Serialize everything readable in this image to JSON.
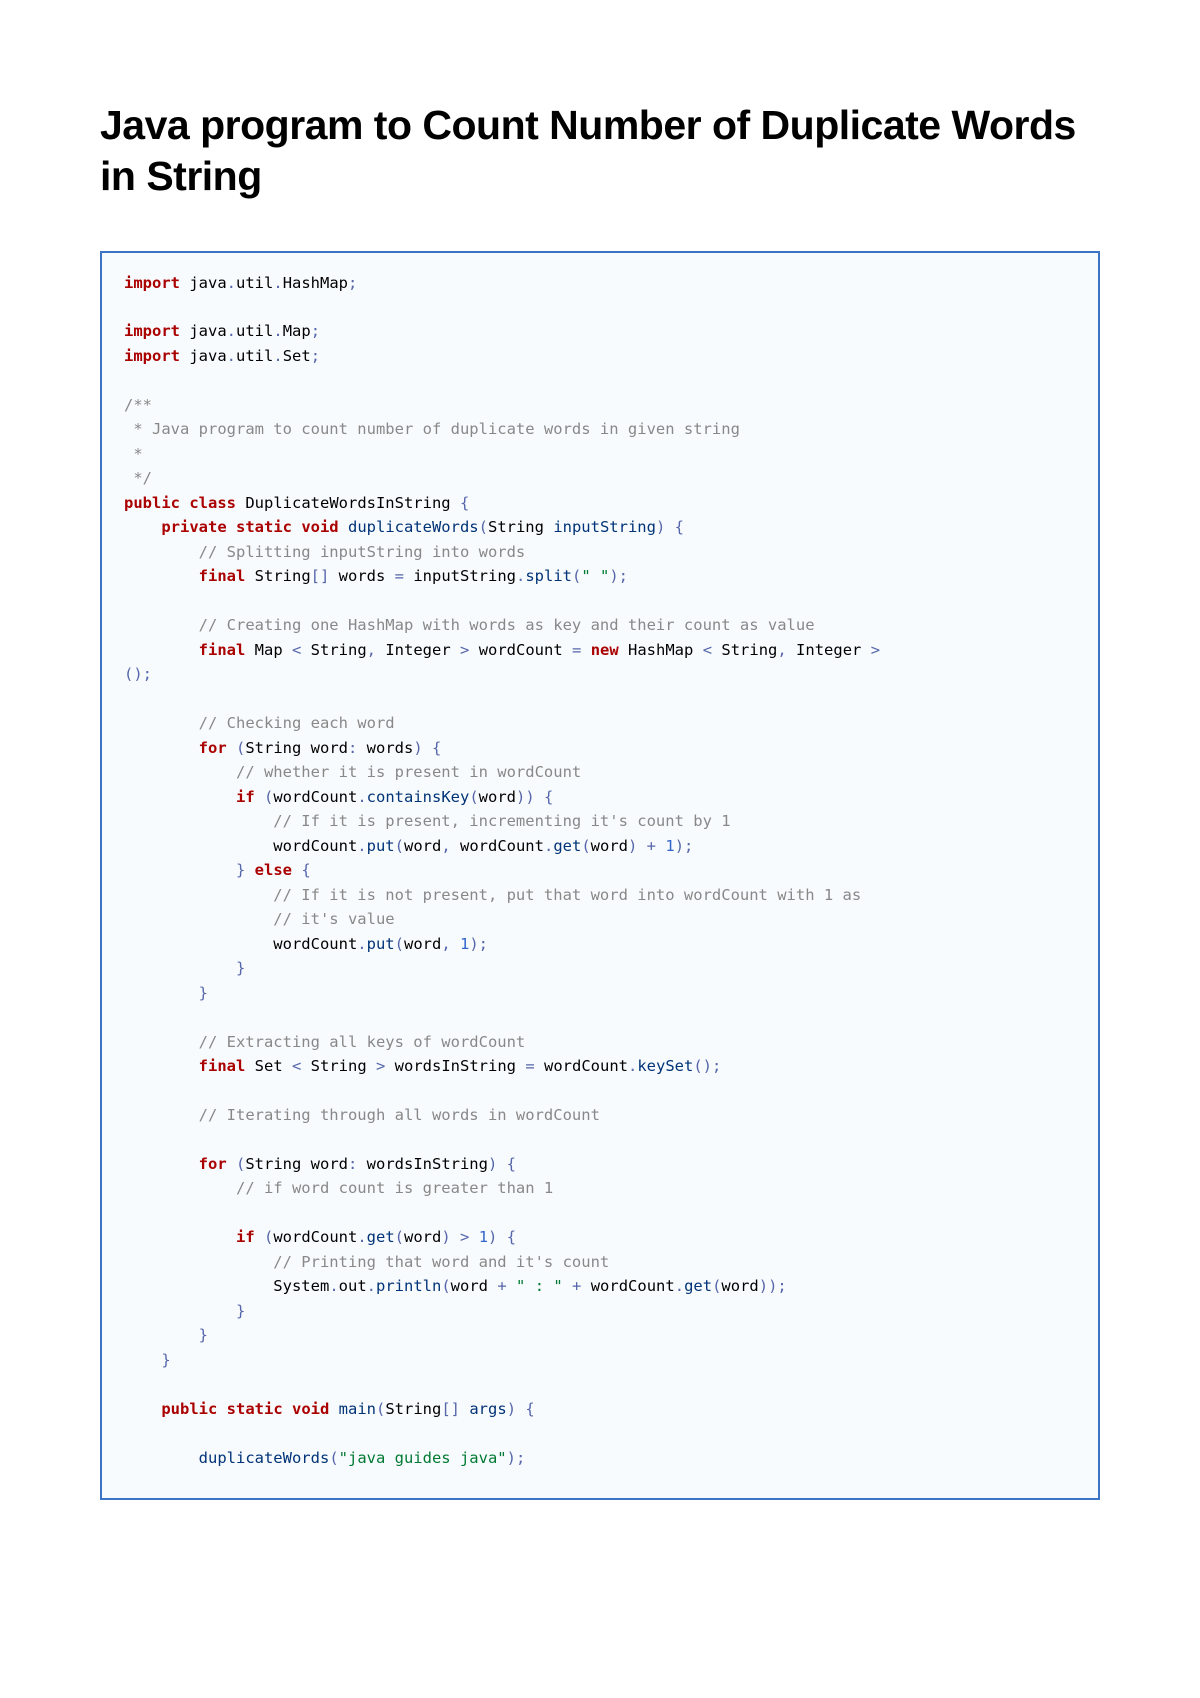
{
  "title": "Java program to Count Number of Duplicate Words in String",
  "code": {
    "l01a": "import",
    "l01b": " java",
    "l01c": ".",
    "l01d": "util",
    "l01e": ".",
    "l01f": "HashMap",
    "l01g": ";",
    "l03a": "import",
    "l03b": " java",
    "l03c": ".",
    "l03d": "util",
    "l03e": ".",
    "l03f": "Map",
    "l03g": ";",
    "l04a": "import",
    "l04b": " java",
    "l04c": ".",
    "l04d": "util",
    "l04e": ".",
    "l04f": "Set",
    "l04g": ";",
    "l06": "/**",
    "l07": " * Java program to count number of duplicate words in given string",
    "l08": " *",
    "l09": " */",
    "l10a": "public",
    "l10b": " class",
    "l10c": " DuplicateWordsInString ",
    "l10d": "{",
    "l11a": "    private",
    "l11b": " static",
    "l11c": " void",
    "l11d": " duplicateWords",
    "l11e": "(",
    "l11f": "String ",
    "l11g": "inputString",
    "l11h": ") {",
    "l12": "        // Splitting inputString into words",
    "l13a": "        final",
    "l13b": " String",
    "l13c": "[]",
    "l13d": " words ",
    "l13e": "=",
    "l13f": " inputString",
    "l13g": ".",
    "l13h": "split",
    "l13i": "(",
    "l13j": "\" \"",
    "l13k": ");",
    "l15": "        // Creating one HashMap with words as key and their count as value",
    "l16a": "        final",
    "l16b": " Map ",
    "l16c": "<",
    "l16d": " String",
    "l16e": ",",
    "l16f": " Integer ",
    "l16g": ">",
    "l16h": " wordCount ",
    "l16i": "=",
    "l16j": " new",
    "l16k": " HashMap ",
    "l16l": "<",
    "l16m": " String",
    "l16n": ",",
    "l16o": " Integer ",
    "l16p": ">",
    "l16q": "",
    "l17": "();",
    "l19": "        // Checking each word",
    "l20a": "        for",
    "l20b": " (",
    "l20c": "String word",
    "l20d": ":",
    "l20e": " words",
    "l20f": ") {",
    "l21": "            // whether it is present in wordCount",
    "l22a": "            if",
    "l22b": " (",
    "l22c": "wordCount",
    "l22d": ".",
    "l22e": "containsKey",
    "l22f": "(",
    "l22g": "word",
    "l22h": ")) {",
    "l23": "                // If it is present, incrementing it's count by 1",
    "l24a": "                wordCount",
    "l24b": ".",
    "l24c": "put",
    "l24d": "(",
    "l24e": "word",
    "l24f": ",",
    "l24g": " wordCount",
    "l24h": ".",
    "l24i": "get",
    "l24j": "(",
    "l24k": "word",
    "l24l": ") ",
    "l24m": "+",
    "l24n": " ",
    "l24o": "1",
    "l24p": ");",
    "l25a": "            } ",
    "l25b": "else",
    "l25c": " {",
    "l26": "                // If it is not present, put that word into wordCount with 1 as",
    "l27": "                // it's value",
    "l28a": "                wordCount",
    "l28b": ".",
    "l28c": "put",
    "l28d": "(",
    "l28e": "word",
    "l28f": ",",
    "l28g": " ",
    "l28h": "1",
    "l28i": ");",
    "l29": "            }",
    "l30": "        }",
    "l32": "        // Extracting all keys of wordCount",
    "l33a": "        final",
    "l33b": " Set ",
    "l33c": "<",
    "l33d": " String ",
    "l33e": ">",
    "l33f": " wordsInString ",
    "l33g": "=",
    "l33h": " wordCount",
    "l33i": ".",
    "l33j": "keySet",
    "l33k": "();",
    "l35": "        // Iterating through all words in wordCount",
    "l37a": "        for",
    "l37b": " (",
    "l37c": "String word",
    "l37d": ":",
    "l37e": " wordsInString",
    "l37f": ") {",
    "l38": "            // if word count is greater than 1",
    "l40a": "            if",
    "l40b": " (",
    "l40c": "wordCount",
    "l40d": ".",
    "l40e": "get",
    "l40f": "(",
    "l40g": "word",
    "l40h": ") ",
    "l40i": ">",
    "l40j": " ",
    "l40k": "1",
    "l40l": ") {",
    "l41": "                // Printing that word and it's count",
    "l42a": "                System",
    "l42b": ".",
    "l42c": "out",
    "l42d": ".",
    "l42e": "println",
    "l42f": "(",
    "l42g": "word ",
    "l42h": "+",
    "l42i": " ",
    "l42j": "\" : \"",
    "l42k": " ",
    "l42l": "+",
    "l42m": " wordCount",
    "l42n": ".",
    "l42o": "get",
    "l42p": "(",
    "l42q": "word",
    "l42r": "));",
    "l43": "            }",
    "l44": "        }",
    "l45": "    }",
    "l47a": "    public",
    "l47b": " static",
    "l47c": " void",
    "l47d": " main",
    "l47e": "(",
    "l47f": "String",
    "l47g": "[]",
    "l47h": " args",
    "l47i": ") {",
    "l49a": "        duplicateWords",
    "l49b": "(",
    "l49c": "\"java guides java\"",
    "l49d": ");"
  }
}
